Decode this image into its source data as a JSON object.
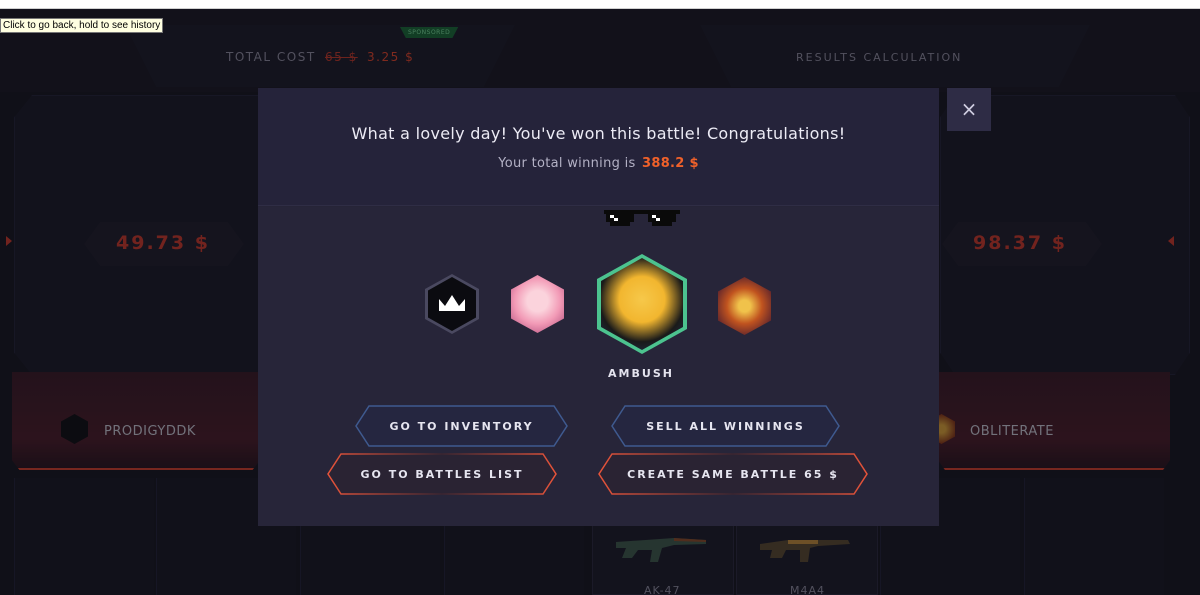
{
  "browser": {
    "tooltip": "Click to go back, hold to see history"
  },
  "header": {
    "total_cost_label": "TOTAL COST",
    "old_price": "65 $",
    "new_price": "3.25 $",
    "sponsored_label": "SPONSORED",
    "results_label": "RESULTS CALCULATION"
  },
  "left_panel": {
    "amount": "49.73 $",
    "player_name": "PRODIGYDDK"
  },
  "right_panel": {
    "amount": "98.37 $",
    "player_name": "OBLITERATE"
  },
  "items": [
    {
      "name": "AK-47"
    },
    {
      "name": "M4A4"
    }
  ],
  "modal": {
    "title": "What a lovely day! You've won this battle! Congratulations!",
    "subtitle_prefix": "Your total winning is",
    "total_winning": "388.2 $",
    "close_icon": "×",
    "winner_name": "AMBUSH",
    "buttons": {
      "go_to_inventory": "GO TO INVENTORY",
      "sell_all_winnings": "SELL ALL WINNINGS",
      "go_to_battles_list": "GO TO BATTLES LIST",
      "create_same_battle": "CREATE SAME BATTLE 65 $"
    }
  },
  "colors": {
    "accent_red": "#d2402f",
    "accent_orange": "#f0612a",
    "winner_ring": "#4cc38f",
    "blue_outline": "#3f5a8f",
    "modal_bg": "#262437"
  },
  "icons": [
    "crown-icon",
    "close-icon",
    "deal-with-it-glasses-icon",
    "ak47-icon",
    "m4a4-icon"
  ]
}
